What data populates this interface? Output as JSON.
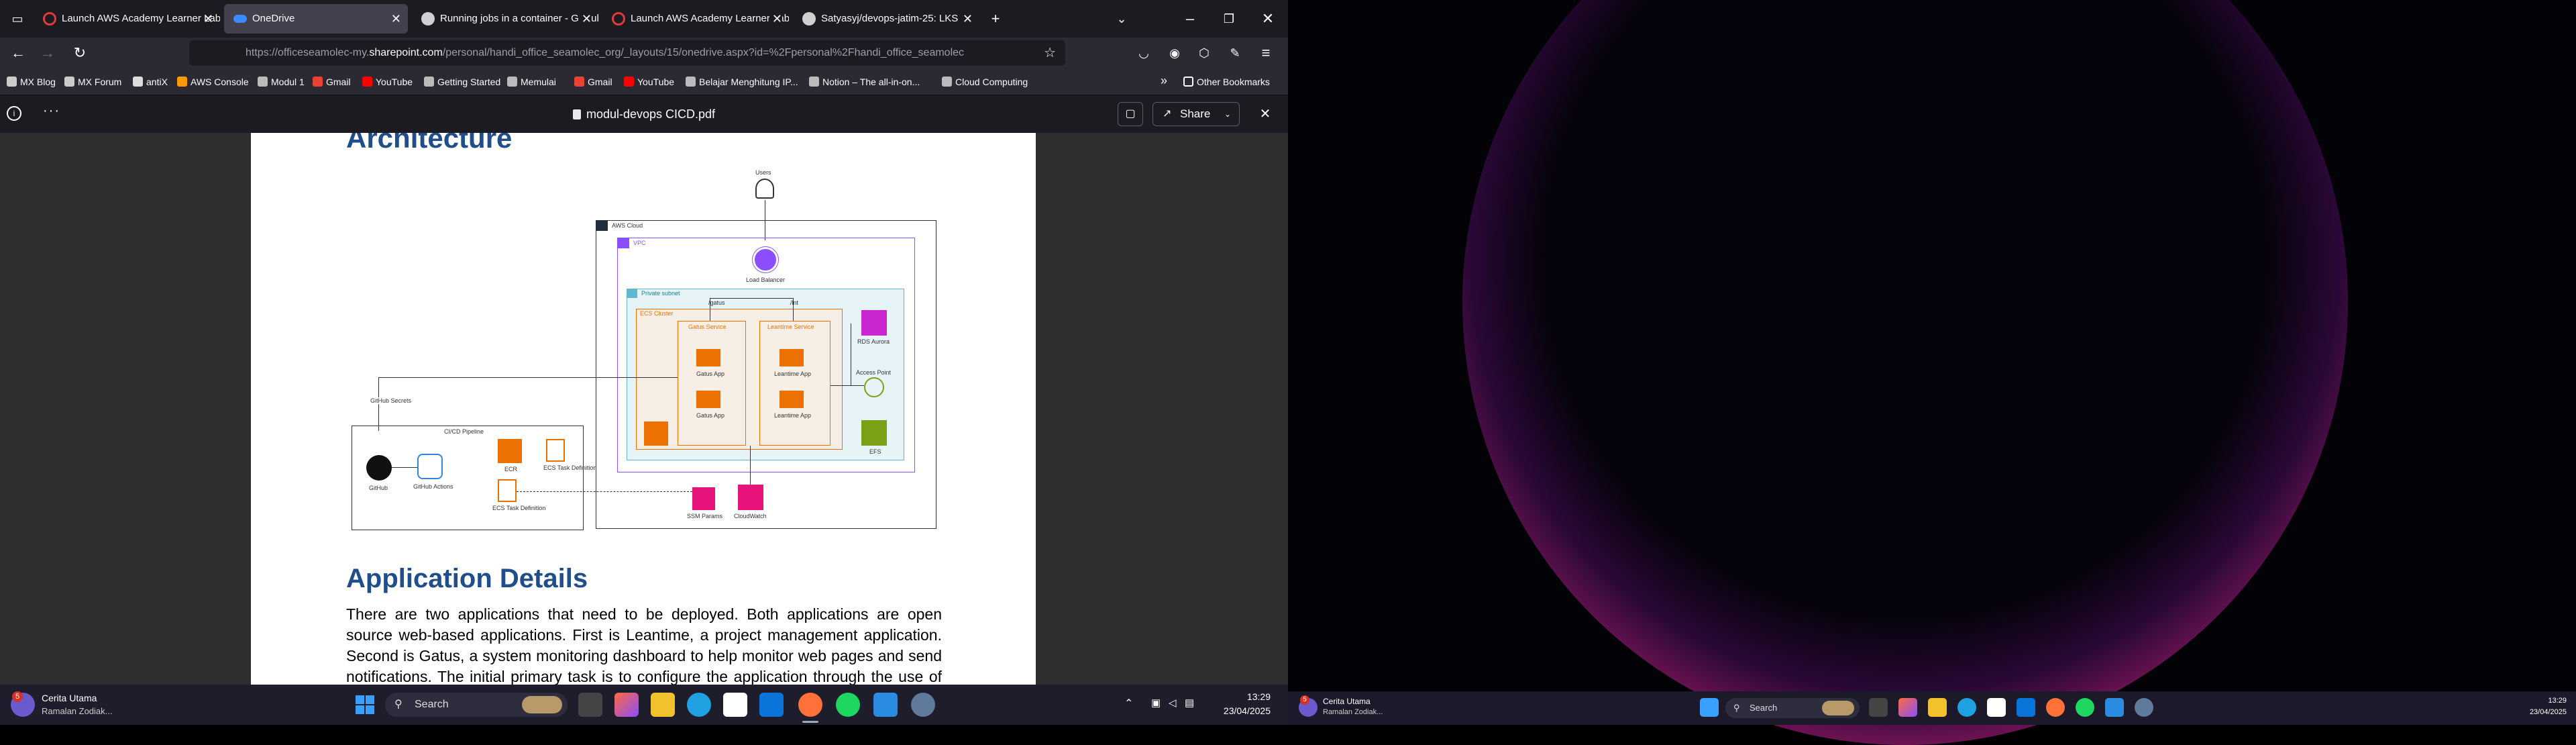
{
  "browser": {
    "tabs": [
      {
        "title": "Launch AWS Academy Learner Lab",
        "color": "#e23a3a"
      },
      {
        "title": "OneDrive",
        "color": "#3a8bff"
      },
      {
        "title": "Running jobs in a container - GitHub",
        "color": "#d0d0d0"
      },
      {
        "title": "Launch AWS Academy Learner Lab",
        "color": "#e23a3a"
      },
      {
        "title": "Satyasyj/devops-jatim-25: LKS",
        "color": "#d0d0d0"
      }
    ],
    "url_prefix": "https://officeseamolec-my.",
    "url_domain": "sharepoint.com",
    "url_rest": "/personal/handi_office_seamolec_org/_layouts/15/onedrive.aspx?id=%2Fpersonal%2Fhandi_office_seamolec",
    "bookmarks": [
      {
        "label": "MX Blog",
        "color": "#cccccc"
      },
      {
        "label": "MX Forum",
        "color": "#cccccc"
      },
      {
        "label": "antiX",
        "color": "#dddddd"
      },
      {
        "label": "AWS Console",
        "color": "#ff9900"
      },
      {
        "label": "Modul 1",
        "color": "#bbbbbb"
      },
      {
        "label": "Gmail",
        "color": "#ea4335"
      },
      {
        "label": "YouTube",
        "color": "#ff0000"
      },
      {
        "label": "Getting Started",
        "color": "#bbbbbb"
      },
      {
        "label": "Memulai",
        "color": "#bbbbbb"
      },
      {
        "label": "Gmail",
        "color": "#ea4335"
      },
      {
        "label": "YouTube",
        "color": "#ff0000"
      },
      {
        "label": "Belajar Menghitung IP...",
        "color": "#bbbbbb"
      },
      {
        "label": "Notion – The all-in-on...",
        "color": "#bbbbbb"
      },
      {
        "label": "Cloud Computing",
        "color": "#bbbbbb"
      }
    ],
    "other_bookmarks": "Other Bookmarks"
  },
  "pdf": {
    "filename": "modul-devops CICD.pdf",
    "share_label": "Share",
    "heading_architecture": "Architecture",
    "heading_app_details": "Application Details",
    "paragraph_lines": [
      "There are two applications that need to be deployed. Both applications are open",
      "source web-based applications. First is Leantime, a project management application.",
      "Second is Gatus, a system monitoring dashboard to help monitor web pages and send",
      "notifications. The initial primary task is to configure the application through the use of"
    ]
  },
  "diagram": {
    "users": "Users",
    "aws_cloud": "AWS Cloud",
    "vpc": "VPC",
    "load_balancer": "Load Balancer",
    "private_subnet": "Private subnet",
    "ecs_cluster": "ECS Cluster",
    "gatus_service": "Gatus Service",
    "leantime_service": "Leantime Service",
    "gatus_app": "Gatus App",
    "leantime_app": "Leantime App",
    "rds": "RDS Aurora",
    "access_point": "Access Point",
    "efs": "EFS",
    "path_a": "/gatus",
    "path_b": "/lnt",
    "github_secrets": "GitHub Secrets",
    "cicd_pipeline": "CI/CD Pipeline",
    "github": "GitHub",
    "github_actions": "GitHub Actions",
    "ecr": "ECR",
    "ecs_task_def": "ECS Task Definition",
    "ssm": "SSM Params",
    "cloudwatch": "CloudWatch"
  },
  "taskbar": {
    "weather_title": "Cerita Utama",
    "weather_sub": "Ramalan Zodiak...",
    "badge": "5",
    "search": "Search",
    "time": "13:29",
    "date": "23/04/2025"
  }
}
